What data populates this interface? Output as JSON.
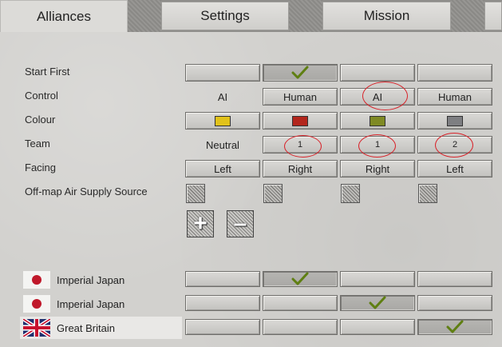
{
  "tabs": [
    {
      "label": "Alliances",
      "active": true
    },
    {
      "label": "Settings",
      "active": false
    },
    {
      "label": "Mission",
      "active": false
    }
  ],
  "rows": {
    "start_first": "Start First",
    "control": "Control",
    "colour": "Colour",
    "team": "Team",
    "facing": "Facing",
    "air_supply": "Off-map Air Supply Source"
  },
  "columns": [
    {
      "start_first": false,
      "control": "AI",
      "control_is_button": false,
      "colour": "#e1c21a",
      "team": "Neutral",
      "team_is_button": false,
      "facing": "Left"
    },
    {
      "start_first": true,
      "control": "Human",
      "control_is_button": true,
      "colour": "#b3261c",
      "team": "1",
      "team_is_button": true,
      "facing": "Right"
    },
    {
      "start_first": false,
      "control": "AI",
      "control_is_button": true,
      "colour": "#7f8a24",
      "team": "1",
      "team_is_button": true,
      "facing": "Right"
    },
    {
      "start_first": false,
      "control": "Human",
      "control_is_button": true,
      "colour": "#7e7f82",
      "team": "2",
      "team_is_button": true,
      "facing": "Left"
    }
  ],
  "buttons": {
    "add": "+",
    "remove": "–"
  },
  "nations": [
    {
      "name": "Imperial Japan",
      "flag": "japan-flag",
      "assigned_column": 2
    },
    {
      "name": "Imperial Japan",
      "flag": "japan-flag",
      "assigned_column": 3
    },
    {
      "name": "Great Britain",
      "flag": "uk-flag",
      "assigned_column": 4
    }
  ],
  "colors": {
    "check": "#5f7f12",
    "annotation": "#d8232a",
    "background": "#d2d1ce"
  }
}
